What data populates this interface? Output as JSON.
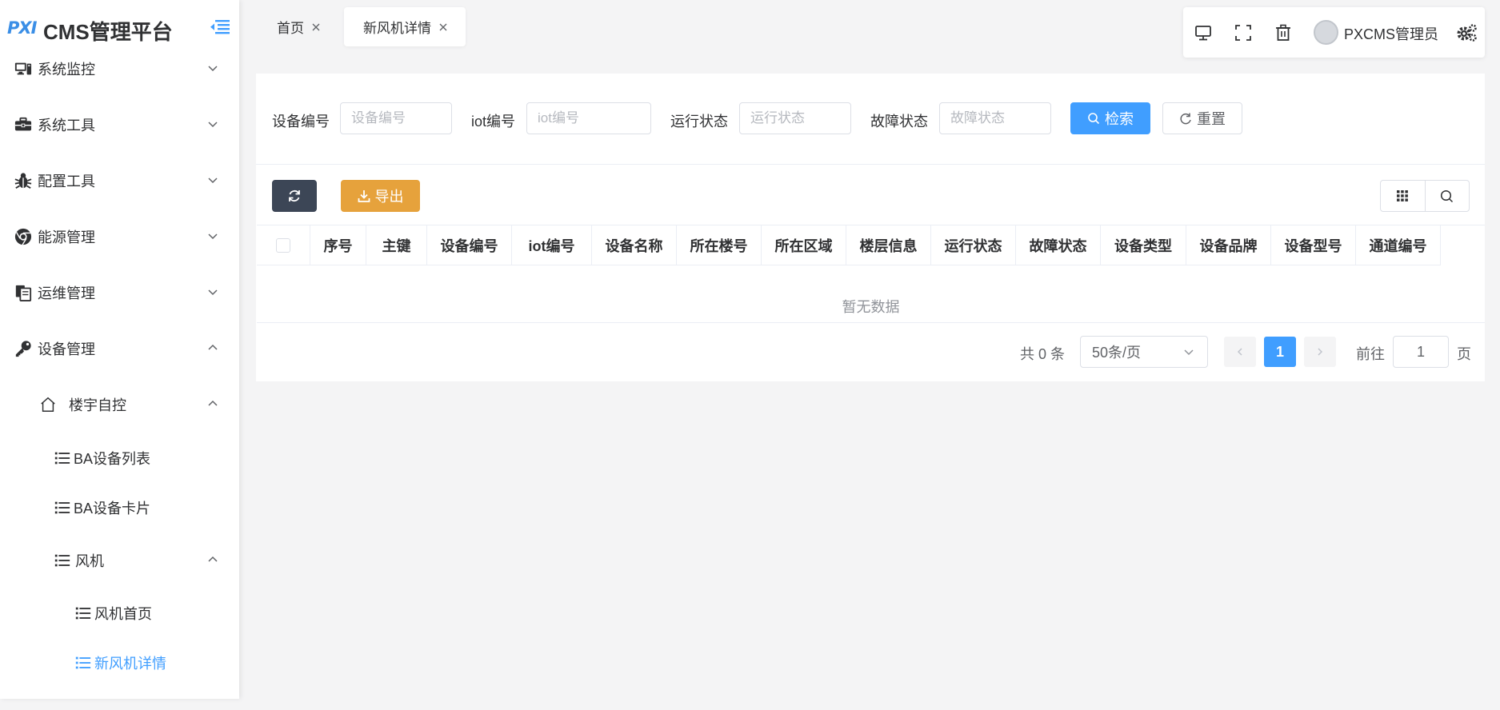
{
  "app": {
    "logo_text": "PXI",
    "title": "CMS管理平台"
  },
  "sidebar": {
    "items": [
      {
        "label": "系统监控",
        "icon": "monitor-icon",
        "expanded": false
      },
      {
        "label": "系统工具",
        "icon": "toolbox-icon",
        "expanded": false
      },
      {
        "label": "配置工具",
        "icon": "bug-icon",
        "expanded": false
      },
      {
        "label": "能源管理",
        "icon": "chrome-icon",
        "expanded": false
      },
      {
        "label": "运维管理",
        "icon": "clipboard-icon",
        "expanded": false
      },
      {
        "label": "设备管理",
        "icon": "key-icon",
        "expanded": true
      },
      {
        "label": "楼宇自控",
        "icon": "home-icon",
        "expanded": true
      },
      {
        "label": "BA设备列表",
        "icon": "list-icon"
      },
      {
        "label": "BA设备卡片",
        "icon": "list-icon"
      },
      {
        "label": "风机",
        "icon": "list-icon",
        "expanded": true
      },
      {
        "label": "风机首页",
        "icon": "list-icon"
      },
      {
        "label": "新风机详情",
        "icon": "list-icon",
        "active": true
      }
    ]
  },
  "tabs": [
    {
      "label": "首页",
      "active": false
    },
    {
      "label": "新风机详情",
      "active": true
    }
  ],
  "toolbar": {
    "username": "PXCMS管理员",
    "icons": [
      "desktop-icon",
      "fullscreen-icon",
      "trash-icon",
      "avatar",
      "settings-icon"
    ]
  },
  "search": {
    "fields": [
      {
        "label": "设备编号",
        "placeholder": "设备编号",
        "value": ""
      },
      {
        "label": "iot编号",
        "placeholder": "iot编号",
        "value": ""
      },
      {
        "label": "运行状态",
        "placeholder": "运行状态",
        "value": ""
      },
      {
        "label": "故障状态",
        "placeholder": "故障状态",
        "value": ""
      }
    ],
    "search_label": "检索",
    "reset_label": "重置"
  },
  "actions": {
    "export_label": "导出"
  },
  "table": {
    "columns": [
      "序号",
      "主键",
      "设备编号",
      "iot编号",
      "设备名称",
      "所在楼号",
      "所在区域",
      "楼层信息",
      "运行状态",
      "故障状态",
      "设备类型",
      "设备品牌",
      "设备型号",
      "通道编号"
    ],
    "rows": [],
    "empty_text": "暂无数据"
  },
  "pagination": {
    "total_text": "共 0 条",
    "page_size_text": "50条/页",
    "current_page": "1",
    "goto_label": "前往",
    "goto_value": "1",
    "page_suffix": "页"
  },
  "colors": {
    "primary": "#409eff",
    "warning": "#e6a23c",
    "dark": "#3c4656"
  }
}
